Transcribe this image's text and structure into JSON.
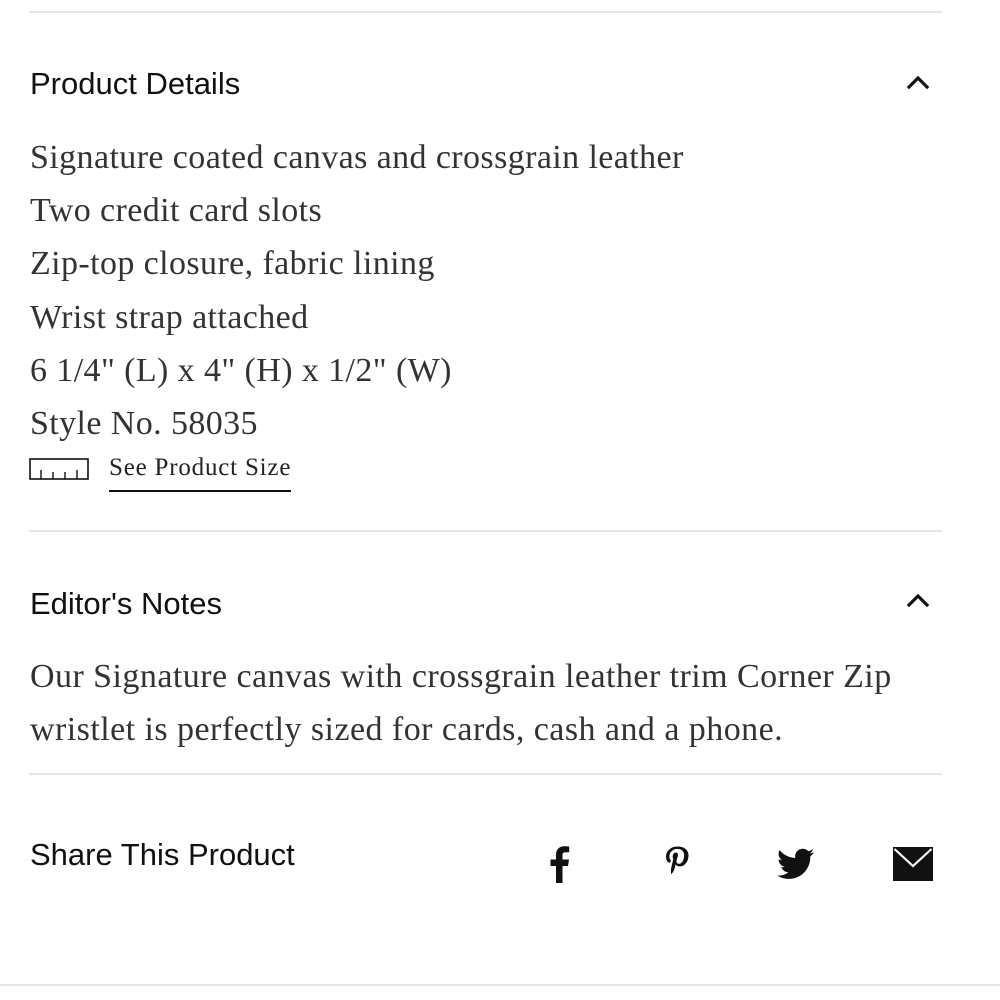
{
  "product_details": {
    "heading": "Product Details",
    "expanded": true,
    "items": [
      "Signature coated canvas and crossgrain leather",
      "Two credit card slots",
      "Zip-top closure, fabric lining",
      "Wrist strap attached",
      "6 1/4\" (L) x 4\" (H) x 1/2\" (W)",
      "Style No. 58035"
    ],
    "size_link": {
      "icon": "ruler-icon",
      "label": "See Product Size"
    }
  },
  "editors_notes": {
    "heading": "Editor's Notes",
    "expanded": true,
    "text": "Our Signature canvas with crossgrain leather trim Corner Zip wristlet is perfectly sized for cards, cash and a phone."
  },
  "share": {
    "heading": "Share This Product",
    "icons": [
      "facebook-icon",
      "pinterest-icon",
      "twitter-icon",
      "email-icon"
    ]
  },
  "colors": {
    "text": "#1a1a1a",
    "body_text": "#333333",
    "divider": "#e6e6ea"
  }
}
